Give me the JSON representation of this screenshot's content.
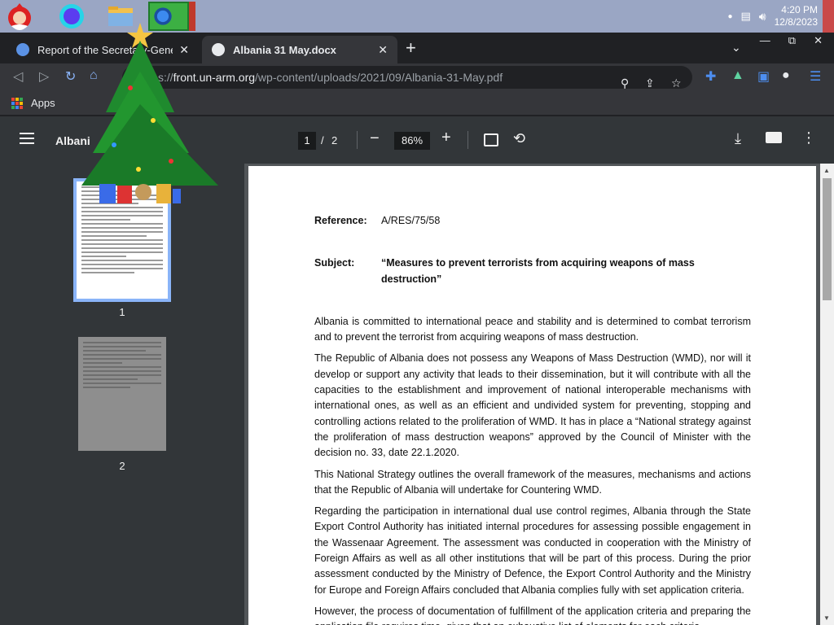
{
  "taskbar": {
    "clock_time": "4:20 PM",
    "clock_date": "12/8/2023"
  },
  "tabs": [
    {
      "title": "Report of the Secretary-General o",
      "close": "✕"
    },
    {
      "title": "Albania 31 May.docx",
      "close": "✕"
    }
  ],
  "new_tab": "+",
  "window": {
    "minimize": "—",
    "restore": "⧉",
    "close": "✕"
  },
  "url": {
    "host": "front.un-arm.org",
    "path": "/wp-content/uploads/2021/09/Albania-31-May.pdf",
    "prefix": "s://"
  },
  "bookmarks": {
    "apps_label": "Apps"
  },
  "pdf": {
    "title": "Albani",
    "current_page": "1",
    "separator": "/",
    "total_pages": "2",
    "zoom_out": "−",
    "zoom": "86%",
    "zoom_in": "+",
    "thumbnails": [
      {
        "number": "1"
      },
      {
        "number": "2"
      }
    ]
  },
  "document": {
    "reference_label": "Reference:",
    "reference_value": "A/RES/75/58",
    "subject_label": "Subject:",
    "subject_value": "“Measures to prevent terrorists from acquiring weapons of mass destruction”",
    "paragraphs": [
      "Albania is committed to international peace and stability and is determined to combat terrorism and to prevent the terrorist from acquiring weapons of mass destruction.",
      "The Republic of Albania does not possess any Weapons of Mass Destruction (WMD), nor will it develop or support any activity that leads to their dissemination, but it will contribute with all the capacities to the establishment and improvement of national interoperable mechanisms with international ones, as well as an efficient and undivided system for preventing, stopping and controlling actions related to the proliferation of WMD. It has in place a “National strategy against the proliferation of mass destruction weapons” approved by the Council of Minister with the decision no. 33, date 22.1.2020.",
      "This National Strategy outlines the overall framework of the measures, mechanisms and actions that the Republic of Albania will undertake for Countering WMD.",
      "Regarding the participation in international dual use control regimes, Albania through the State Export Control Authority has initiated internal procedures for assessing possible engagement in the Wassenaar Agreement. The assessment was conducted in cooperation with the Ministry of Foreign Affairs as well as all other institutions that will be part of this process. During the prior assessment conducted by the Ministry of Defence, the Export Control Authority and the Ministry for Europe and Foreign Affairs concluded that Albania complies fully with set application criteria.",
      "However, the process of documentation of fulfillment of the application criteria and preparing the application file requires time, given that an exhaustive list of elements for each criteria"
    ]
  }
}
